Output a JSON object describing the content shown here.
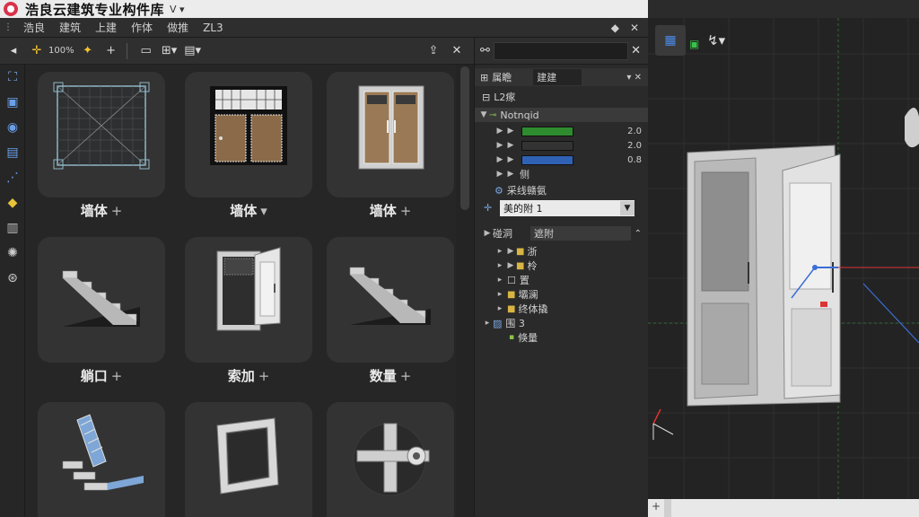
{
  "title_bar": {
    "title": "浩良云建筑专业构件库",
    "suffix": "ᐯ ▾"
  },
  "menu": {
    "items": [
      "浩良",
      "建筑",
      "上建",
      "作体",
      "做推",
      "ZL3"
    ],
    "right_icons": [
      "◆",
      "✕",
      "⊗"
    ]
  },
  "toolbar": {
    "zoom": "100%"
  },
  "left_tools": [
    "layers-icon",
    "box-icon",
    "circle-icon",
    "file-icon",
    "node-icon",
    "tag-icon",
    "trash-icon",
    "gear-icon",
    "scan-icon"
  ],
  "library": {
    "tiles": [
      {
        "label": "墙体",
        "mod": "+"
      },
      {
        "label": "墙体",
        "mod": "▾"
      },
      {
        "label": "墙体",
        "mod": "+"
      },
      {
        "label": "躺口",
        "mod": "+"
      },
      {
        "label": "索加",
        "mod": "+"
      },
      {
        "label": "数量",
        "mod": "+"
      },
      {
        "label": "",
        "mod": ""
      },
      {
        "label": "",
        "mod": ""
      },
      {
        "label": "",
        "mod": ""
      }
    ]
  },
  "panel": {
    "tab_left": "属瞻",
    "tab_right": "建建",
    "layer": "L2瘃",
    "group": "Notnqid",
    "props": [
      {
        "color": "#2e8b2e",
        "value": "2.0"
      },
      {
        "color": "#333333",
        "value": "2.0"
      },
      {
        "color": "#2f62b5",
        "value": "0.8"
      }
    ],
    "extra_item": "侧",
    "section_title": "采线赣氨",
    "dropdown_value": "美的附 1",
    "tree_header_left": "碰洞",
    "tree_header_right": "遮附",
    "tree_items": [
      "浙",
      "柃",
      "置",
      "壩澜",
      "终体撬",
      "围 3",
      "倏量"
    ]
  }
}
